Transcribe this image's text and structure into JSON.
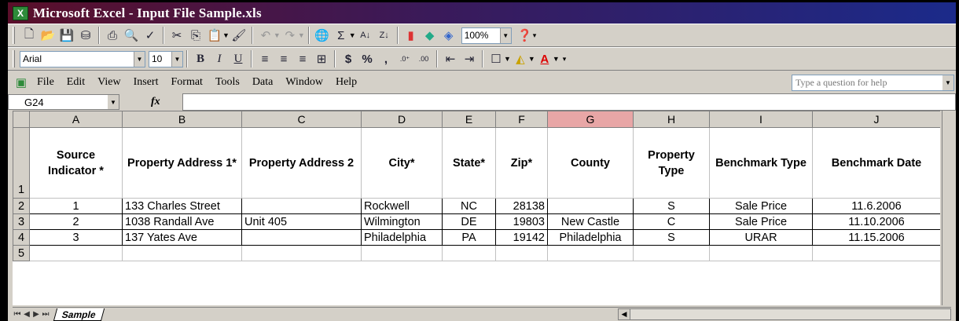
{
  "window": {
    "title": "Microsoft Excel - Input File Sample.xls",
    "app_icon": "excel-icon"
  },
  "toolbar": {
    "zoom": "100%"
  },
  "format": {
    "font": "Arial",
    "size": "10"
  },
  "menu": [
    "File",
    "Edit",
    "View",
    "Insert",
    "Format",
    "Tools",
    "Data",
    "Window",
    "Help"
  ],
  "help_box": {
    "placeholder": "Type a question for help"
  },
  "name_box": "G24",
  "fx_label": "fx",
  "columns": [
    "A",
    "B",
    "C",
    "D",
    "E",
    "F",
    "G",
    "H",
    "I",
    "J"
  ],
  "selected_column": "G",
  "rows": [
    "1",
    "2",
    "3",
    "4",
    "5"
  ],
  "headers": [
    "Source Indicator *",
    "Property Address 1*",
    "Property Address 2",
    "City*",
    "State*",
    "Zip*",
    "County",
    "Property Type",
    "Benchmark Type",
    "Benchmark Date"
  ],
  "data": [
    [
      "1",
      "133 Charles Street",
      "",
      "Rockwell",
      "NC",
      "28138",
      "",
      "S",
      "Sale Price",
      "11.6.2006"
    ],
    [
      "2",
      "1038 Randall Ave",
      "Unit 405",
      "Wilmington",
      "DE",
      "19803",
      "New Castle",
      "C",
      "Sale Price",
      "11.10.2006"
    ],
    [
      "3",
      "137 Yates Ave",
      "",
      "Philadelphia",
      "PA",
      "19142",
      "Philadelphia",
      "S",
      "URAR",
      "11.15.2006"
    ]
  ],
  "sheet_tab": "Sample"
}
